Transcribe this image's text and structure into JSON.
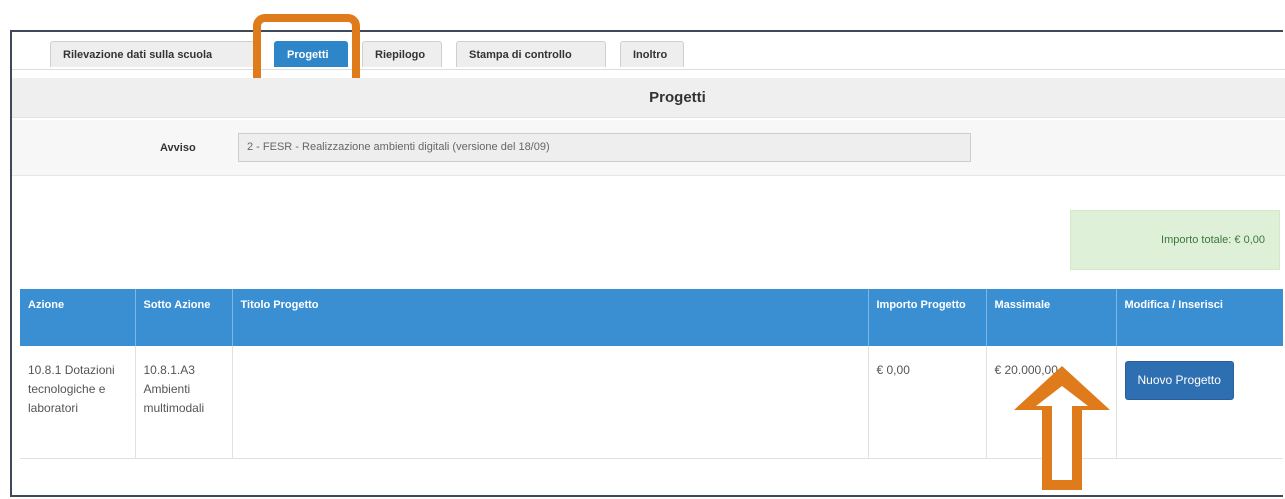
{
  "tabs": [
    {
      "label": "Rilevazione dati sulla scuola",
      "active": false
    },
    {
      "label": "Progetti",
      "active": true
    },
    {
      "label": "Riepilogo",
      "active": false
    },
    {
      "label": "Stampa di controllo",
      "active": false
    },
    {
      "label": "Inoltro",
      "active": false
    }
  ],
  "page_title": "Progetti",
  "avviso": {
    "label": "Avviso",
    "value": "2 - FESR - Realizzazione ambienti digitali (versione del 18/09)"
  },
  "importo_totale": "Importo totale: € 0,00",
  "table": {
    "headers": [
      "Azione",
      "Sotto Azione",
      "Titolo Progetto",
      "Importo Progetto",
      "Massimale",
      "Modifica / Inserisci"
    ],
    "row": {
      "azione": "10.8.1 Dotazioni tecnologiche e laboratori",
      "sotto_azione": "10.8.1.A3 Ambienti multimodali",
      "titolo": "",
      "importo": "€ 0,00",
      "massimale": "€ 20.000,00",
      "button_label": "Nuovo Progetto"
    }
  },
  "annotation_color": "#e07b1c",
  "accent_color": "#3a8fd3"
}
